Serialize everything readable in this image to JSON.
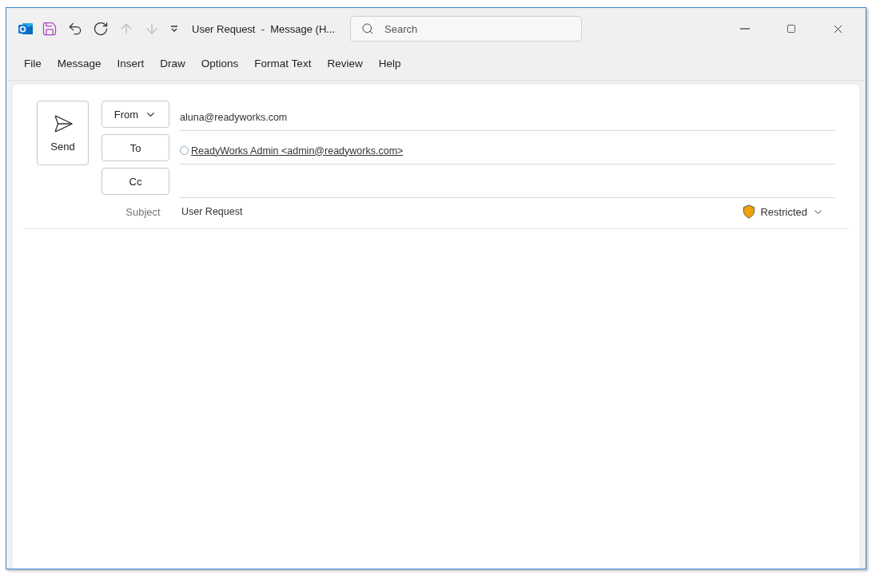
{
  "window": {
    "title": "User Request  -  Message (H...",
    "search": {
      "placeholder": "Search"
    }
  },
  "quick_access": [
    {
      "kind": "save",
      "disabled": false
    },
    {
      "kind": "undo",
      "disabled": false
    },
    {
      "kind": "redo",
      "disabled": false
    },
    {
      "kind": "up",
      "disabled": true
    },
    {
      "kind": "down",
      "disabled": true
    },
    {
      "kind": "customize",
      "disabled": false
    }
  ],
  "menu": [
    "File",
    "Message",
    "Insert",
    "Draw",
    "Options",
    "Format Text",
    "Review",
    "Help"
  ],
  "compose": {
    "send": "Send",
    "fields": [
      {
        "kind": "dropdown",
        "label": "From",
        "value": "aluna@readyworks.com"
      },
      {
        "kind": "recipient",
        "label": "To",
        "value": "ReadyWorks Admin <admin@readyworks.com>"
      },
      {
        "kind": "recipient",
        "label": "Cc"
      }
    ],
    "subject": {
      "label": "Subject",
      "value": "User Request"
    },
    "sensitivity": {
      "label": "Restricted",
      "color": "#f0a30a"
    }
  }
}
